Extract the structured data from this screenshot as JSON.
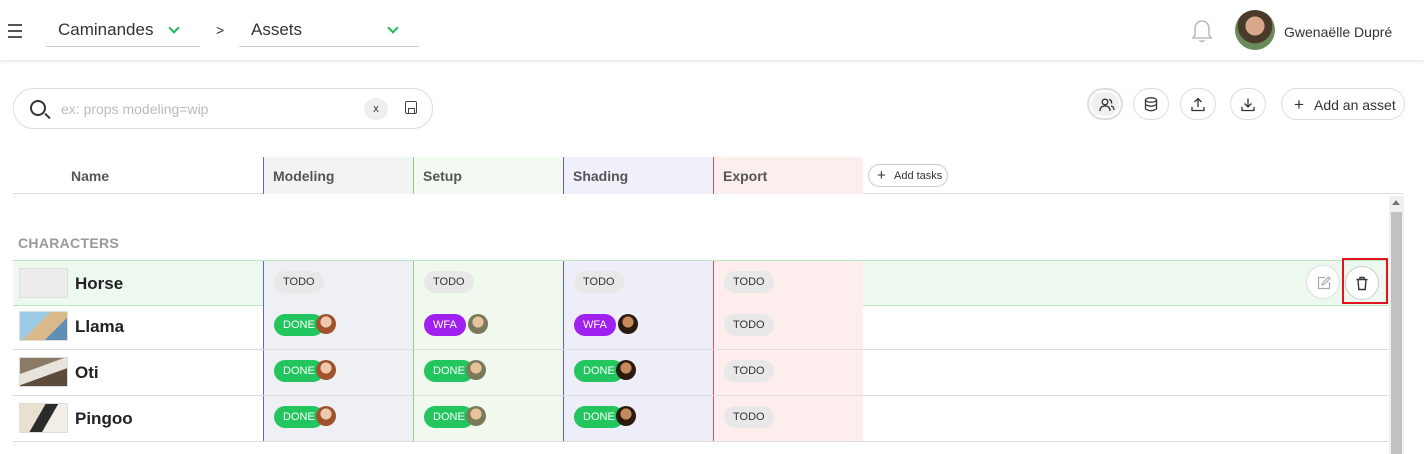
{
  "topbar": {
    "production": "Caminandes",
    "separator": ">",
    "section": "Assets",
    "user_name": "Gwenaëlle Dupré"
  },
  "search": {
    "placeholder": "ex: props modeling=wip",
    "value": "",
    "clear_label": "x"
  },
  "toolbar": {
    "add_asset_label": "Add an asset",
    "icons": [
      "people-icon",
      "database-icon",
      "upload-icon",
      "download-icon"
    ]
  },
  "table": {
    "columns": [
      {
        "label": "Name"
      },
      {
        "label": "Modeling",
        "color": "#eef0f3"
      },
      {
        "label": "Setup",
        "color": "#f1f9ef"
      },
      {
        "label": "Shading",
        "color": "#eeeef9"
      },
      {
        "label": "Export",
        "color": "#fdeded"
      }
    ],
    "add_tasks_label": "Add tasks",
    "section": "CHARACTERS",
    "rows": [
      {
        "name": "Horse",
        "statuses": [
          "TODO",
          "TODO",
          "TODO",
          "TODO"
        ]
      },
      {
        "name": "Llama",
        "statuses": [
          "DONE",
          "WFA",
          "WFA",
          "TODO"
        ]
      },
      {
        "name": "Oti",
        "statuses": [
          "DONE",
          "DONE",
          "DONE",
          "TODO"
        ]
      },
      {
        "name": "Pingoo",
        "statuses": [
          "DONE",
          "DONE",
          "DONE",
          "TODO"
        ]
      }
    ]
  },
  "colors": {
    "done": "#22c55e",
    "wfa": "#a020f0",
    "todo": "#e8e8e8",
    "accent": "#1eb85a",
    "highlight": "#e0141e"
  }
}
